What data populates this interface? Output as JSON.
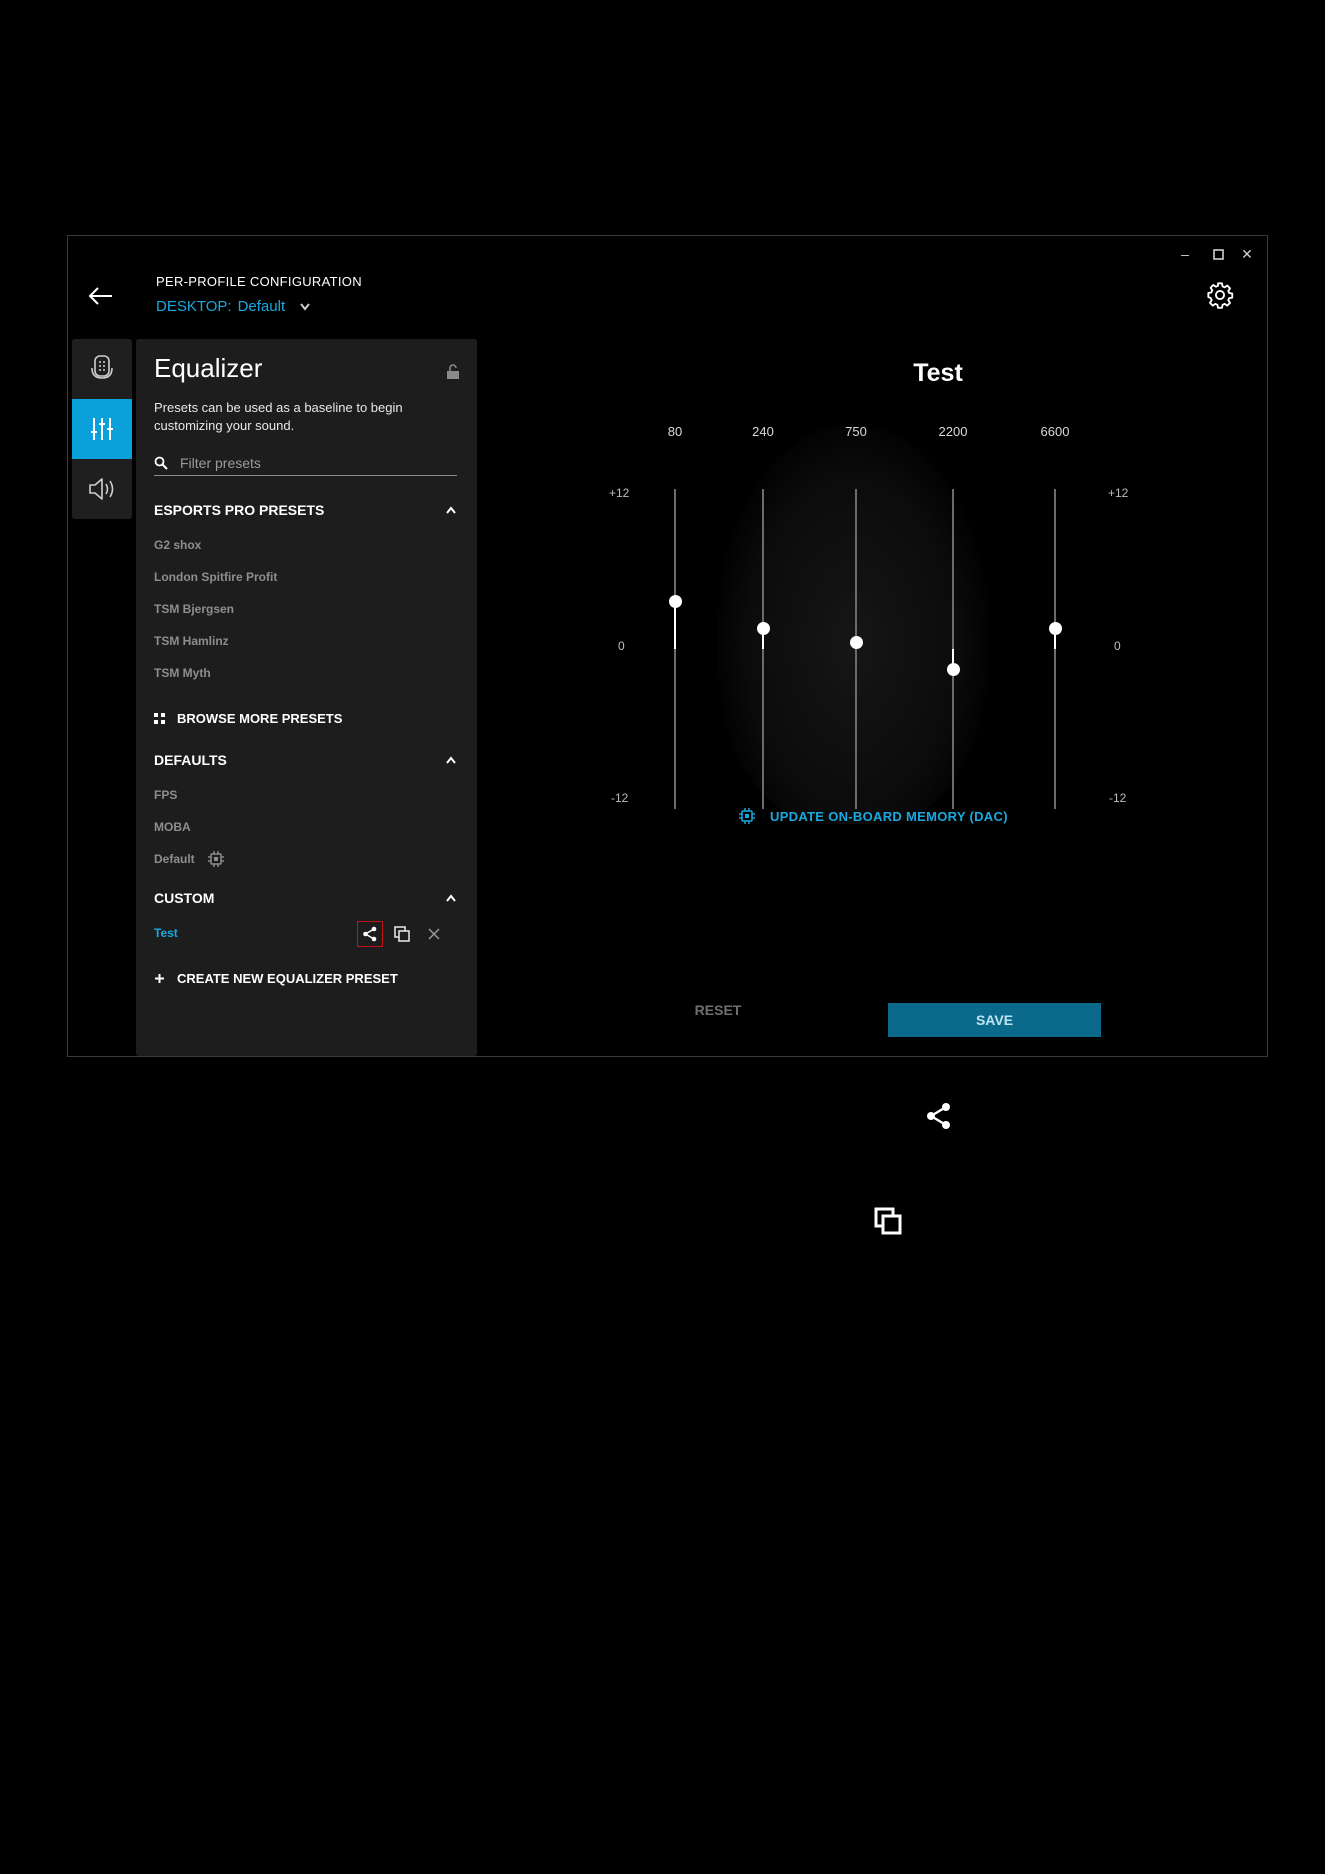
{
  "window": {
    "minimize": "–",
    "maximize": "☐",
    "close": "✕"
  },
  "header": {
    "title": "PER-PROFILE CONFIGURATION",
    "profile_prefix": "DESKTOP:",
    "profile_name": "Default"
  },
  "panel": {
    "title": "Equalizer",
    "description": "Presets can be used as a baseline to begin customizing your sound.",
    "search_placeholder": "Filter presets",
    "sections": {
      "esports": {
        "label": "ESPORTS PRO PRESETS",
        "items": [
          "G2 shox",
          "London Spitfire Profit",
          "TSM Bjergsen",
          "TSM Hamlinz",
          "TSM Myth"
        ]
      },
      "browse_label": "BROWSE MORE PRESETS",
      "defaults": {
        "label": "DEFAULTS",
        "items": [
          "FPS",
          "MOBA",
          "Default"
        ]
      },
      "custom": {
        "label": "CUSTOM",
        "items": [
          "Test"
        ]
      },
      "create_label": "CREATE NEW EQUALIZER PRESET"
    }
  },
  "equalizer": {
    "preset_name": "Test",
    "scale": {
      "top": "+12",
      "mid": "0",
      "bottom": "-12"
    },
    "range_db": [
      -12,
      12
    ],
    "bands": [
      {
        "freq": "80",
        "gain_db": 3.6
      },
      {
        "freq": "240",
        "gain_db": 1.6
      },
      {
        "freq": "750",
        "gain_db": 0.5
      },
      {
        "freq": "2200",
        "gain_db": -1.5
      },
      {
        "freq": "6600",
        "gain_db": 1.6
      }
    ]
  },
  "footer": {
    "update_label": "UPDATE ON-BOARD MEMORY (DAC)",
    "reset_label": "RESET",
    "save_label": "SAVE"
  },
  "colors": {
    "accent": "#19a9df",
    "active_tab": "#0aa0da",
    "save_bg": "#0b6a8b",
    "highlight_box": "#c0141a"
  }
}
